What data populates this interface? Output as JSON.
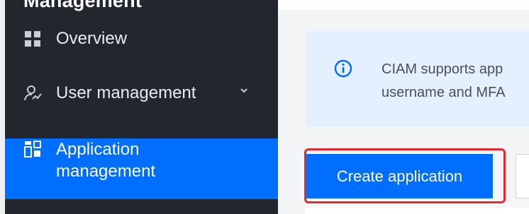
{
  "sidebar": {
    "heading": "Management",
    "items": [
      {
        "label": "Overview",
        "icon": "grid-icon"
      },
      {
        "label": "User management",
        "icon": "user-icon",
        "expand_icon": "chevron-down-icon"
      },
      {
        "label": "Application management",
        "icon": "apps-icon",
        "active": true
      }
    ]
  },
  "notice": {
    "icon": "info-icon",
    "line1": "CIAM supports app",
    "line2": "username and MFA"
  },
  "toolbar": {
    "create_label": "Create application"
  },
  "colors": {
    "sidebar_bg": "#23262d",
    "accent": "#006eff",
    "notice_bg": "#e5f0ff",
    "highlight": "#e8282b"
  }
}
